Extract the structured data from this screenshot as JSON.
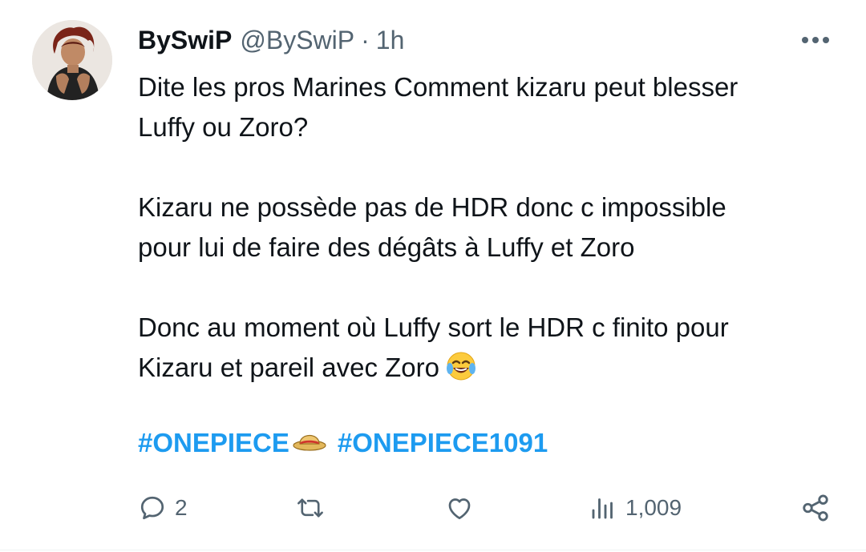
{
  "author": {
    "display_name": "BySwiP",
    "handle": "@BySwiP",
    "separator": "·",
    "time": "1h"
  },
  "tweet": {
    "paragraphs": [
      [
        "Dite les pros Marines Comment kizaru peut blesser",
        "Luffy ou Zoro?"
      ],
      [
        "Kizaru ne possède pas de HDR donc c impossible",
        "pour lui de faire des dégâts à Luffy et Zoro"
      ],
      [
        "Donc au moment où Luffy sort le HDR c finito pour",
        "Kizaru et pareil avec Zoro"
      ]
    ],
    "line1": "Dite les pros Marines Comment kizaru peut blesser",
    "line2": "Luffy ou Zoro?",
    "line3": "Kizaru ne possède pas de HDR donc c impossible",
    "line4": "pour lui de faire des dégâts à Luffy et Zoro",
    "line5": "Donc au moment où Luffy sort le HDR c finito pour",
    "line6": "Kizaru et pareil avec Zoro",
    "trailing_emoji": "face-with-tears-of-joy-emoji",
    "hashtags": [
      "#ONEPIECE",
      "#ONEPIECE1091"
    ],
    "hashtag_emoji": "straw-hat-emoji"
  },
  "actions": {
    "reply_count": "2",
    "repost_count": "",
    "like_count": "",
    "views_count": "1,009"
  },
  "icons": {
    "more": "more-icon",
    "reply": "reply-icon",
    "repost": "repost-icon",
    "like": "heart-icon",
    "views": "views-icon",
    "share": "share-icon"
  },
  "colors": {
    "text": "#0f1419",
    "secondary": "#536471",
    "link": "#1d9bf0"
  }
}
